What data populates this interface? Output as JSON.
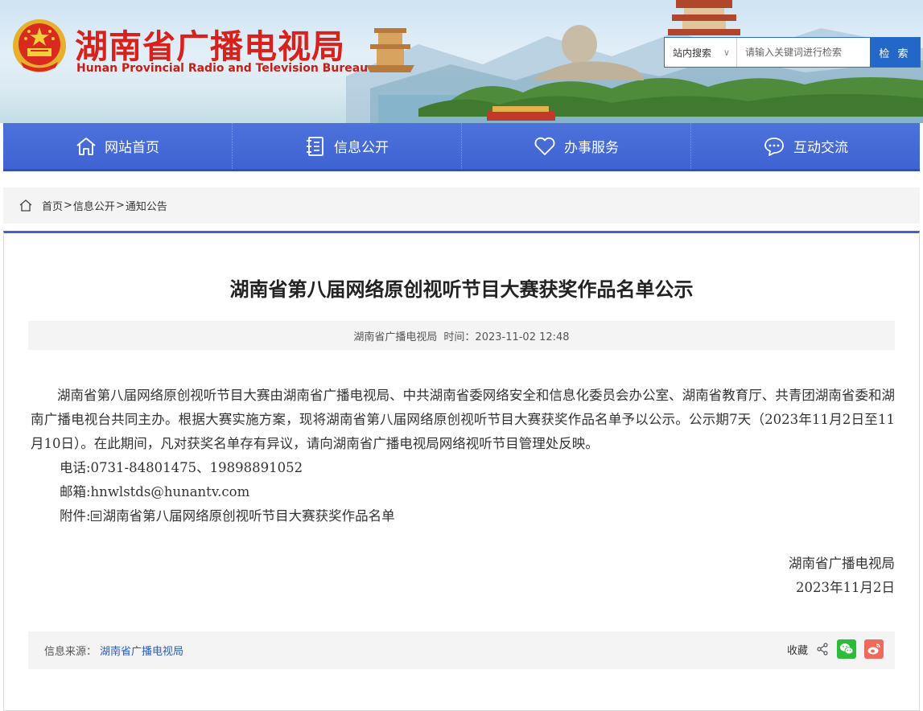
{
  "header": {
    "title_cn": "湖南省广播电视局",
    "title_en": "Hunan Provincial Radio and Television Bureau",
    "brand_color": "#d8211b"
  },
  "search": {
    "scope_label": "站内搜索",
    "placeholder": "请输入关键词进行检索",
    "button_label": "检 索"
  },
  "nav": {
    "items": [
      {
        "label": "网站首页",
        "icon": "home-icon"
      },
      {
        "label": "信息公开",
        "icon": "document-list-icon"
      },
      {
        "label": "办事服务",
        "icon": "heart-icon"
      },
      {
        "label": "互动交流",
        "icon": "chat-bubble-icon"
      }
    ],
    "color": "#4368d5"
  },
  "breadcrumb": {
    "items": [
      "首页",
      "信息公开",
      "通知公告"
    ],
    "separator": ">"
  },
  "article": {
    "title": "湖南省第八届网络原创视听节目大赛获奖作品名单公示",
    "meta_source": "湖南省广播电视局",
    "meta_time": "时间：2023-11-02 12:48",
    "paragraph": "湖南省第八届网络原创视听节目大赛由湖南省广播电视局、中共湖南省委网络安全和信息化委员会办公室、湖南省教育厅、共青团湖南省委和湖南广播电视台共同主办。根据大赛实施方案，现将湖南省第八届网络原创视听节目大赛获奖作品名单予以公示。公示期7天（2023年11月2日至11月10日）。在此期间，凡对获奖名单存有异议，请向湖南省广播电视局网络视听节目管理处反映。",
    "phone": "电话:0731-84801475、19898891052",
    "email": "邮箱:hnwlstds@hunantv.com",
    "attachment_label": "附件:",
    "attachment_name": "湖南省第八届网络原创视听节目大赛获奖作品名单",
    "sign_org": "湖南省广播电视局",
    "sign_date": "2023年11月2日"
  },
  "footer_bar": {
    "source_label": "信息来源：",
    "source_value": "湖南省广播电视局",
    "favorite_label": "收藏",
    "wechat_color": "#2dbb3c",
    "weibo_color": "#ef6a5a"
  }
}
